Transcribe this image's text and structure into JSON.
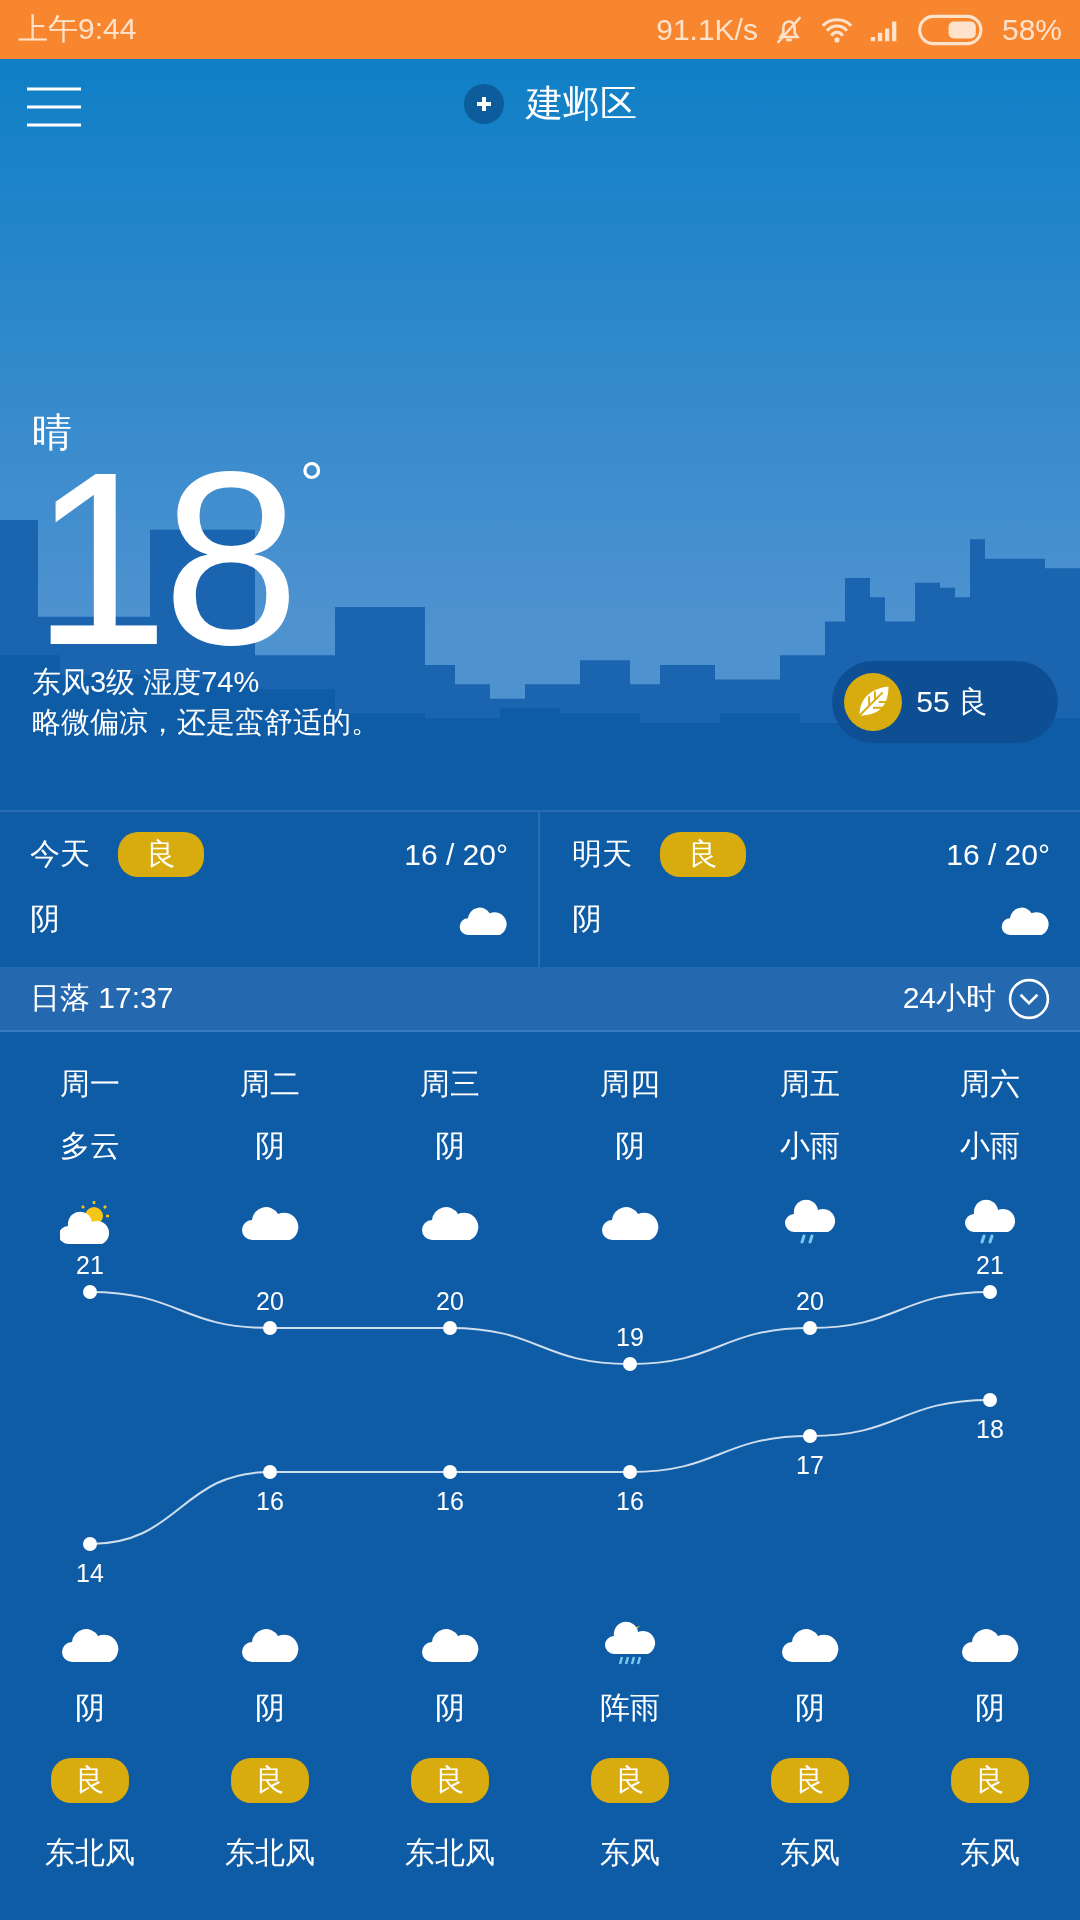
{
  "status_bar": {
    "time": "上午9:44",
    "speed": "91.1K/s",
    "battery": "58%"
  },
  "header": {
    "location": "建邺区"
  },
  "current": {
    "condition": "晴",
    "temp": "18",
    "unit": "°",
    "wind_humidity": "东风3级 湿度74%",
    "comment": "略微偏凉，还是蛮舒适的。",
    "aqi": "55 良"
  },
  "summary": [
    {
      "label": "今天",
      "aqi": "良",
      "range": "16 / 20°",
      "condition": "阴",
      "kind": "cloudy"
    },
    {
      "label": "明天",
      "aqi": "良",
      "range": "16 / 20°",
      "condition": "阴",
      "kind": "cloudy"
    }
  ],
  "sun_bar": {
    "sunset": "日落 17:37",
    "toggle": "24小时"
  },
  "forecast": [
    {
      "weekday": "周一",
      "day": {
        "condition": "多云",
        "kind": "partly"
      },
      "high": "21",
      "low": "14",
      "night": {
        "condition": "阴",
        "kind": "cloudy"
      },
      "aqi": "良",
      "wind": "东北风"
    },
    {
      "weekday": "周二",
      "day": {
        "condition": "阴",
        "kind": "cloudy"
      },
      "high": "20",
      "low": "16",
      "night": {
        "condition": "阴",
        "kind": "cloudy"
      },
      "aqi": "良",
      "wind": "东北风"
    },
    {
      "weekday": "周三",
      "day": {
        "condition": "阴",
        "kind": "cloudy"
      },
      "high": "20",
      "low": "16",
      "night": {
        "condition": "阴",
        "kind": "cloudy"
      },
      "aqi": "良",
      "wind": "东北风"
    },
    {
      "weekday": "周四",
      "day": {
        "condition": "阴",
        "kind": "cloudy"
      },
      "high": "19",
      "low": "16",
      "night": {
        "condition": "阵雨",
        "kind": "shower"
      },
      "aqi": "良",
      "wind": "东风"
    },
    {
      "weekday": "周五",
      "day": {
        "condition": "小雨",
        "kind": "rain"
      },
      "high": "20",
      "low": "17",
      "night": {
        "condition": "阴",
        "kind": "cloudy"
      },
      "aqi": "良",
      "wind": "东风"
    },
    {
      "weekday": "周六",
      "day": {
        "condition": "小雨",
        "kind": "rain"
      },
      "high": "21",
      "low": "18",
      "night": {
        "condition": "阴",
        "kind": "cloudy"
      },
      "aqi": "良",
      "wind": "东风"
    }
  ]
}
